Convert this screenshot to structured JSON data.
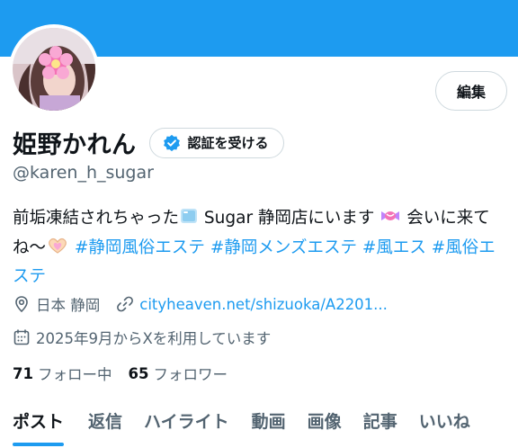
{
  "profile": {
    "display_name": "姫野かれん",
    "handle": "@karen_h_sugar",
    "edit_label": "編集",
    "verify_label": "認証を受ける"
  },
  "bio": {
    "text_1": "前垢凍結されちゃった",
    "text_2": " Sugar 静岡店にいます ",
    "text_3": " 会いに来てね〜",
    "tags": [
      "#静岡風俗エステ",
      "#静岡メンズエステ",
      "#風エス",
      "#風俗エステ"
    ]
  },
  "meta": {
    "location": "日本 静岡",
    "link": "cityheaven.net/shizuoka/A2201...",
    "joined": "2025年9月からXを利用しています"
  },
  "stats": {
    "following_count": "71",
    "following_label": "フォロー中",
    "followers_count": "65",
    "followers_label": "フォロワー"
  },
  "tabs": [
    {
      "label": "ポスト",
      "active": true
    },
    {
      "label": "返信",
      "active": false
    },
    {
      "label": "ハイライト",
      "active": false
    },
    {
      "label": "動画",
      "active": false
    },
    {
      "label": "画像",
      "active": false
    },
    {
      "label": "記事",
      "active": false
    },
    {
      "label": "いいね",
      "active": false
    }
  ],
  "colors": {
    "accent": "#1d9bf0",
    "text": "#0f1419",
    "secondary": "#536471",
    "border": "#cfd9de"
  },
  "icons": {
    "verified": "verified-badge-icon",
    "location": "location-pin-icon",
    "link": "link-icon",
    "calendar": "calendar-icon",
    "ice": "ice-cube-emoji",
    "candy": "candy-emoji",
    "heart_hands": "heart-hands-emoji"
  }
}
